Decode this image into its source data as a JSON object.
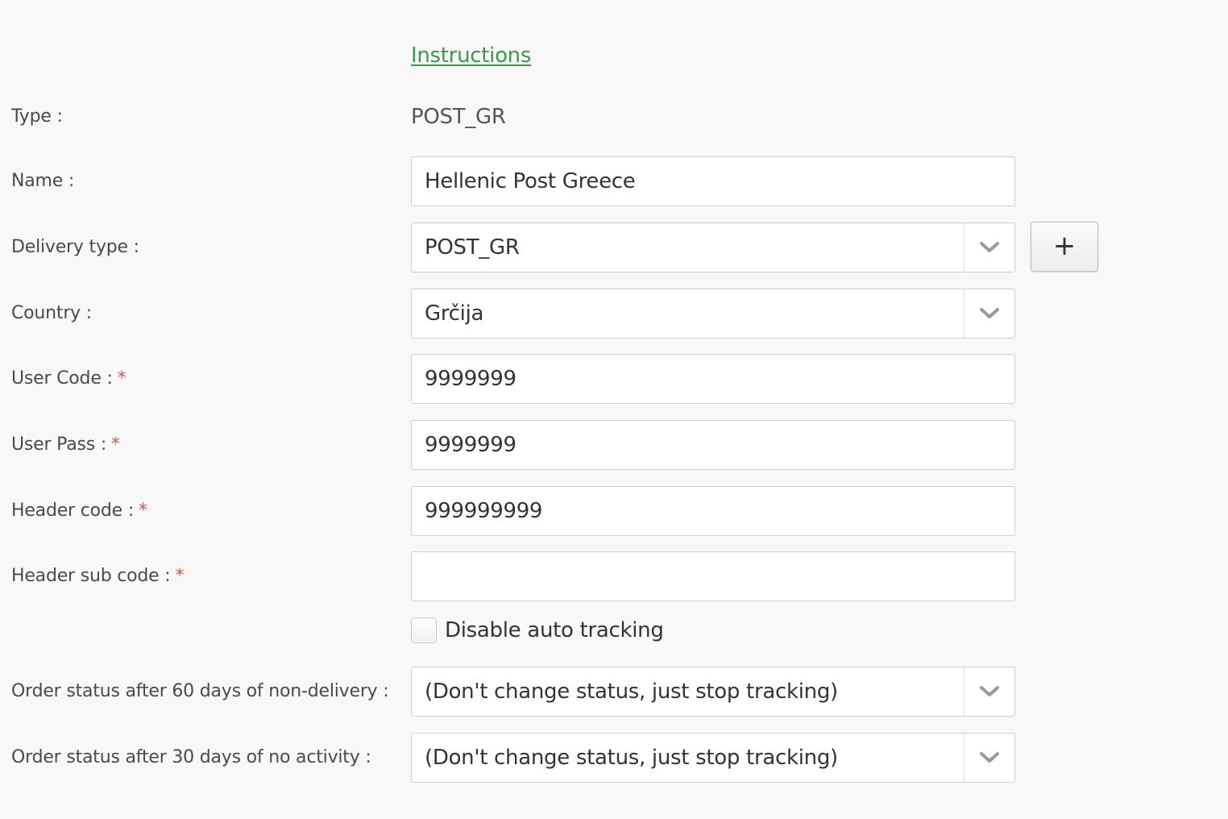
{
  "instructions_link": "Instructions",
  "fields": {
    "type": {
      "label": "Type :",
      "value": "POST_GR"
    },
    "name": {
      "label": "Name :",
      "value": "Hellenic Post Greece"
    },
    "delivery_type": {
      "label": "Delivery type :",
      "value": "POST_GR",
      "add_label": "+"
    },
    "country": {
      "label": "Country :",
      "value": "Grčija"
    },
    "user_code": {
      "label": "User Code :",
      "required": "*",
      "value": "9999999"
    },
    "user_pass": {
      "label": "User Pass :",
      "required": "*",
      "value": "9999999"
    },
    "header_code": {
      "label": "Header code :",
      "required": "*",
      "value": "999999999"
    },
    "header_sub_code": {
      "label": "Header sub code :",
      "required": "*",
      "value": ""
    },
    "disable_auto_tracking": {
      "label": "Disable auto tracking",
      "checked": false
    },
    "status_60_days": {
      "label": "Order status after 60 days of non-delivery :",
      "value": "(Don't change status, just stop tracking)"
    },
    "status_30_days": {
      "label": "Order status after 30 days of no activity :",
      "value": "(Don't change status, just stop tracking)"
    }
  },
  "icons": {
    "dropdown": "chevron-down-icon",
    "add": "plus-icon"
  },
  "colors": {
    "link": "#3a9a4a",
    "required": "#d9534f",
    "background": "#f8f8f8"
  }
}
